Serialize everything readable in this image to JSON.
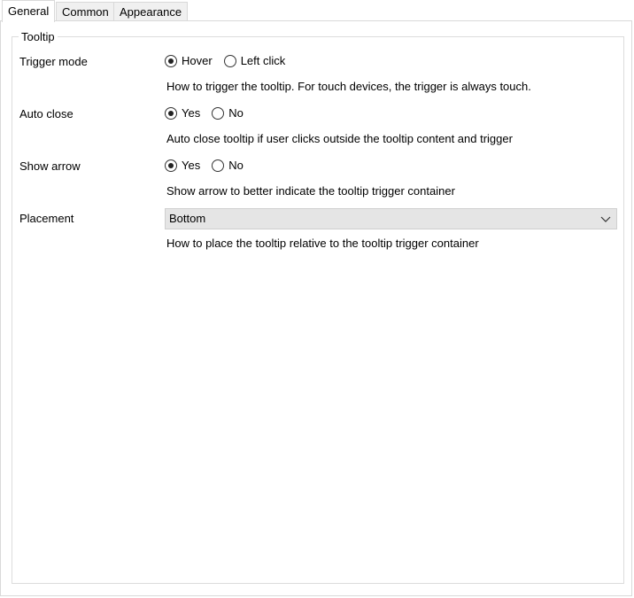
{
  "tabs": [
    {
      "label": "General",
      "active": true
    },
    {
      "label": "Common",
      "active": false
    },
    {
      "label": "Appearance",
      "active": false
    }
  ],
  "group": {
    "title": "Tooltip"
  },
  "fields": {
    "trigger_mode": {
      "label": "Trigger mode",
      "options": [
        {
          "label": "Hover",
          "checked": true
        },
        {
          "label": "Left click",
          "checked": false
        }
      ],
      "help": "How to trigger the tooltip. For touch devices, the trigger is always touch."
    },
    "auto_close": {
      "label": "Auto close",
      "options": [
        {
          "label": "Yes",
          "checked": true
        },
        {
          "label": "No",
          "checked": false
        }
      ],
      "help": "Auto close tooltip if user clicks outside the tooltip content and trigger"
    },
    "show_arrow": {
      "label": "Show arrow",
      "options": [
        {
          "label": "Yes",
          "checked": true
        },
        {
          "label": "No",
          "checked": false
        }
      ],
      "help": "Show arrow to better indicate the tooltip trigger container"
    },
    "placement": {
      "label": "Placement",
      "value": "Bottom",
      "help": "How to place the tooltip relative to the tooltip trigger container"
    }
  },
  "icons": {
    "dropdown": "chevron-down-icon"
  }
}
